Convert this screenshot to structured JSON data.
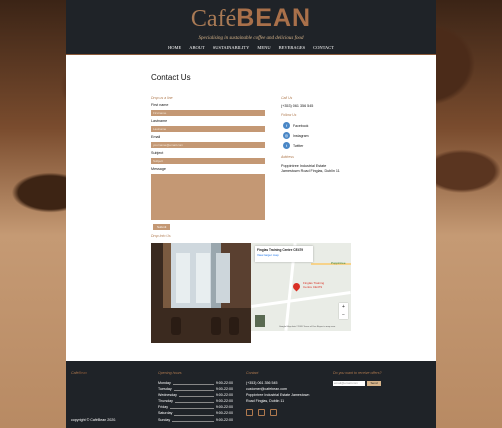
{
  "brand": {
    "logo_part1": "Café",
    "logo_part2": "BEAN",
    "tagline": "Specialising in sustainable coffee and delicious food"
  },
  "nav": [
    "HOME",
    "ABOUT",
    "SUSTAINABILITY",
    "MENU",
    "BEVERAGES",
    "CONTACT"
  ],
  "page_title": "Contact Us",
  "form": {
    "section_label": "Drop us a line",
    "first_name_label": "First name",
    "first_name_placeholder": "Firstname",
    "last_name_label": "Lastname",
    "last_name_placeholder": "Lastname",
    "email_label": "Email",
    "email_placeholder": "yourname@email.com",
    "subject_label": "Subject",
    "subject_placeholder": "Subject",
    "message_label": "Message",
    "submit_label": "Submit"
  },
  "contact": {
    "call_label": "Call Us",
    "phone": "(+353) 061 356 545",
    "follow_label": "Follow Us",
    "socials": [
      "Facebook",
      "Instagram",
      "Twitter"
    ],
    "address_label": "Address",
    "address_line1": "Poppintree Industrial Estate",
    "address_line2": "Jamestown Road Finglas, Dublin 11"
  },
  "find_label": "Drop Into Us",
  "map": {
    "place_title": "Finglas Training Centre CE479",
    "view_larger": "View larger map",
    "pin_label": "Finglas Training Centre CE479",
    "zoom_in": "+",
    "zoom_out": "−",
    "attribution": "Google  Map data ©2020  Terms of Use  Report a map error",
    "area_label": "Poppintree"
  },
  "footer": {
    "brand_1": "Café",
    "brand_2": "Bean",
    "hours_label": "Opening hours",
    "hours": [
      {
        "day": "Monday",
        "time": "9:00-22:00"
      },
      {
        "day": "Tuesday",
        "time": "9:00-22:00"
      },
      {
        "day": "Wednesday",
        "time": "9:00-22:00"
      },
      {
        "day": "Thursday",
        "time": "9:00-22:00"
      },
      {
        "day": "Friday",
        "time": "9:00-22:00"
      },
      {
        "day": "Saturday",
        "time": "9:00-22:00"
      },
      {
        "day": "Sunday",
        "time": "9:00-22:00"
      }
    ],
    "contact_label": "Contact",
    "phone": "(+353) 061 356 545",
    "email": "customer@cafebean.com",
    "addr1": "Poppintree Industrial Estate Jamestown",
    "addr2": "Road Finglas, Dublin 11",
    "offers_label": "Do you want to receive offers?",
    "email_placeholder": "email@email.com",
    "send_label": "Send",
    "copyright": "copyright © CaféBean 2020."
  }
}
